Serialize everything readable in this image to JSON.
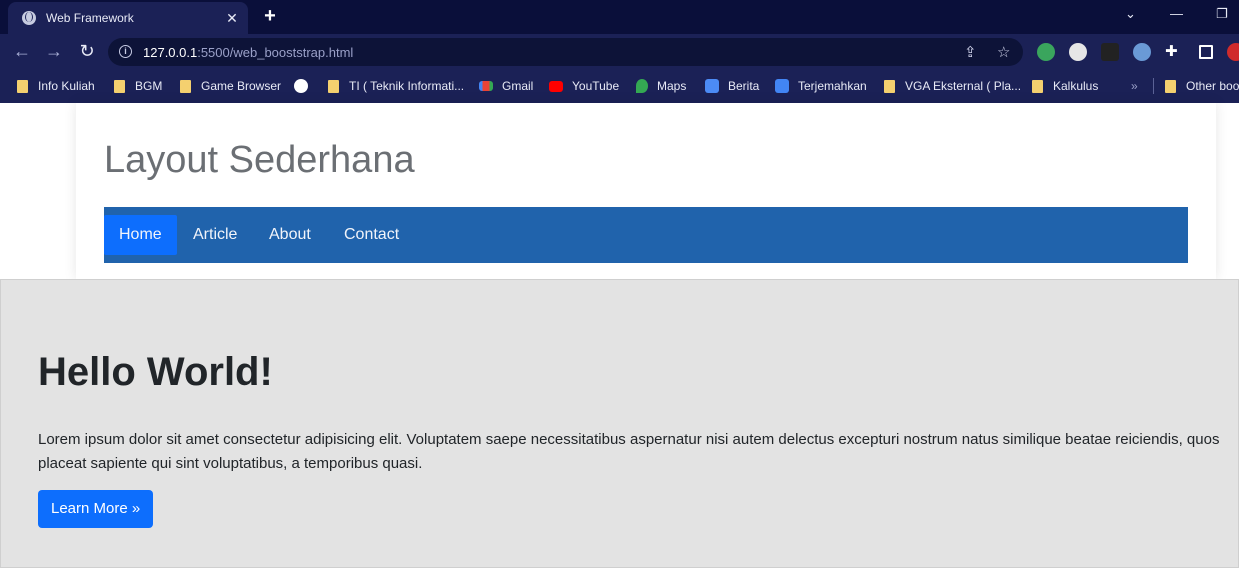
{
  "browser": {
    "tab_title": "Web Framework",
    "tab_close": "✕",
    "new_tab": "+",
    "url_host": "127.0.0.1",
    "url_path": ":5500/web_booststrap.html",
    "back": "←",
    "forward": "→",
    "reload": "↻",
    "window_controls": {
      "dropdown": "⌄",
      "minimize": "—",
      "restore": "❐"
    },
    "bookmarks": [
      {
        "label": "Info Kuliah",
        "icon": "folder-icon"
      },
      {
        "label": "BGM",
        "icon": "folder-icon"
      },
      {
        "label": "Game Browser",
        "icon": "folder-icon"
      },
      {
        "label": "",
        "icon": "globe-icon"
      },
      {
        "label": "TI ( Teknik Informati...",
        "icon": "folder-icon"
      },
      {
        "label": "Gmail",
        "icon": "gmail-icon"
      },
      {
        "label": "YouTube",
        "icon": "youtube-icon"
      },
      {
        "label": "Maps",
        "icon": "maps-icon"
      },
      {
        "label": "Berita",
        "icon": "news-icon"
      },
      {
        "label": "Terjemahkan",
        "icon": "translate-icon"
      },
      {
        "label": "VGA Eksternal ( Pla...",
        "icon": "folder-icon"
      },
      {
        "label": "Kalkulus",
        "icon": "folder-icon"
      }
    ],
    "bookmarks_more": "»",
    "other_bookmarks": "Other boo"
  },
  "site": {
    "title": "Layout Sederhana",
    "nav": [
      {
        "label": "Home",
        "active": true
      },
      {
        "label": "Article",
        "active": false
      },
      {
        "label": "About",
        "active": false
      },
      {
        "label": "Contact",
        "active": false
      }
    ]
  },
  "hero": {
    "title": "Hello World!",
    "text": "Lorem ipsum dolor sit amet consectetur adipisicing elit. Voluptatem saepe necessitatibus aspernatur nisi autem delectus excepturi nostrum natus similique beatae reiciendis, quos placeat sapiente qui sint voluptatibus, a temporibus quasi.",
    "button": "Learn More »"
  },
  "colors": {
    "tabbar": "#0a0f3a",
    "toolbar": "#1b2156",
    "navbar": "#2063ac",
    "primary": "#0d6efd",
    "jumbotron": "#e3e3e3"
  }
}
